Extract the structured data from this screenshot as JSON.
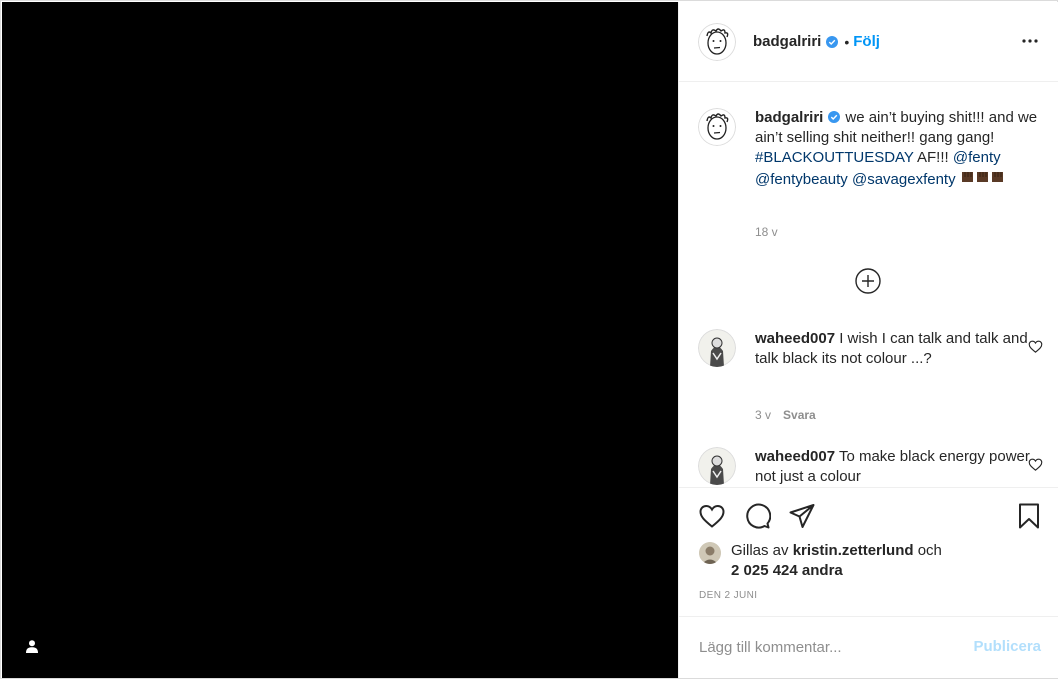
{
  "post": {
    "username": "badgalriri",
    "separator": "•",
    "follow_label": "Följ",
    "more_icon": "more-horizontal-icon",
    "verified_color": "#3897f0",
    "accent": "#0095f6"
  },
  "caption": {
    "username": "badgalriri",
    "text_1": "we ain’t buying shit!!! and we ain’t selling shit neither!! gang gang! ",
    "hashtag": "#BLACKOUTTUESDAY",
    "text_2": " AF!!! ",
    "mention_1": "@fenty",
    "mention_2": "@fentybeauty",
    "mention_3": "@savagexfenty",
    "emoji": "raised-fist-dark-emoji-x3",
    "age": "18 v"
  },
  "comments": [
    {
      "username": "waheed007",
      "text": "I wish I can talk and talk and talk black its not colour ...?",
      "age": "3 v",
      "reply_label": "Svara"
    },
    {
      "username": "waheed007",
      "text": "To make black energy power not just a colour"
    }
  ],
  "likes": {
    "prefix": "Gillas av ",
    "user": "kristin.zetterlund",
    "middle": " och",
    "count": "2 025 424 andra"
  },
  "date": "DEN 2 JUNI",
  "composer": {
    "placeholder": "Lägg till kommentar...",
    "publish_label": "Publicera"
  }
}
